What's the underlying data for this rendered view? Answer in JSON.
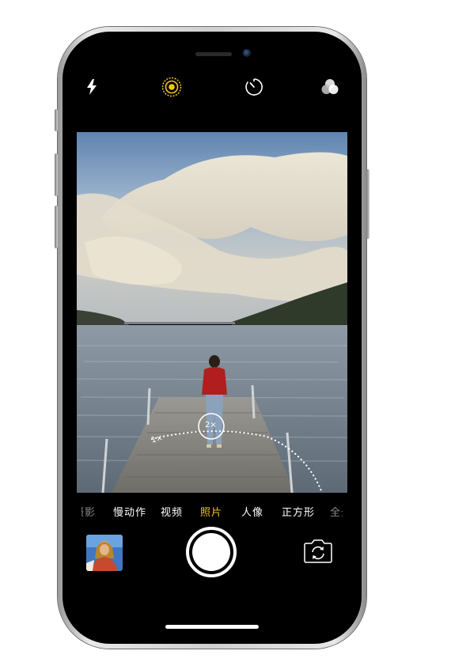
{
  "camera": {
    "top_controls": {
      "flash_icon": "flash-icon",
      "live_photo_icon": "live-photo-icon",
      "timer_icon": "timer-icon",
      "filters_icon": "filters-icon"
    },
    "zoom": {
      "wide_label": "1×",
      "tele_label": "2×"
    },
    "modes": [
      {
        "label": "摄影",
        "state": "faded"
      },
      {
        "label": "慢动作",
        "state": "normal"
      },
      {
        "label": "视频",
        "state": "normal"
      },
      {
        "label": "照片",
        "state": "active"
      },
      {
        "label": "人像",
        "state": "normal"
      },
      {
        "label": "正方形",
        "state": "normal"
      },
      {
        "label": "全景",
        "state": "faded"
      }
    ],
    "bottom_controls": {
      "thumbnail": "last-photo-thumbnail",
      "shutter": "shutter-button",
      "switch_camera_icon": "switch-camera-icon"
    }
  },
  "colors": {
    "accent": "#f5c518",
    "background": "#000000",
    "frame": "#cfcfcf"
  }
}
